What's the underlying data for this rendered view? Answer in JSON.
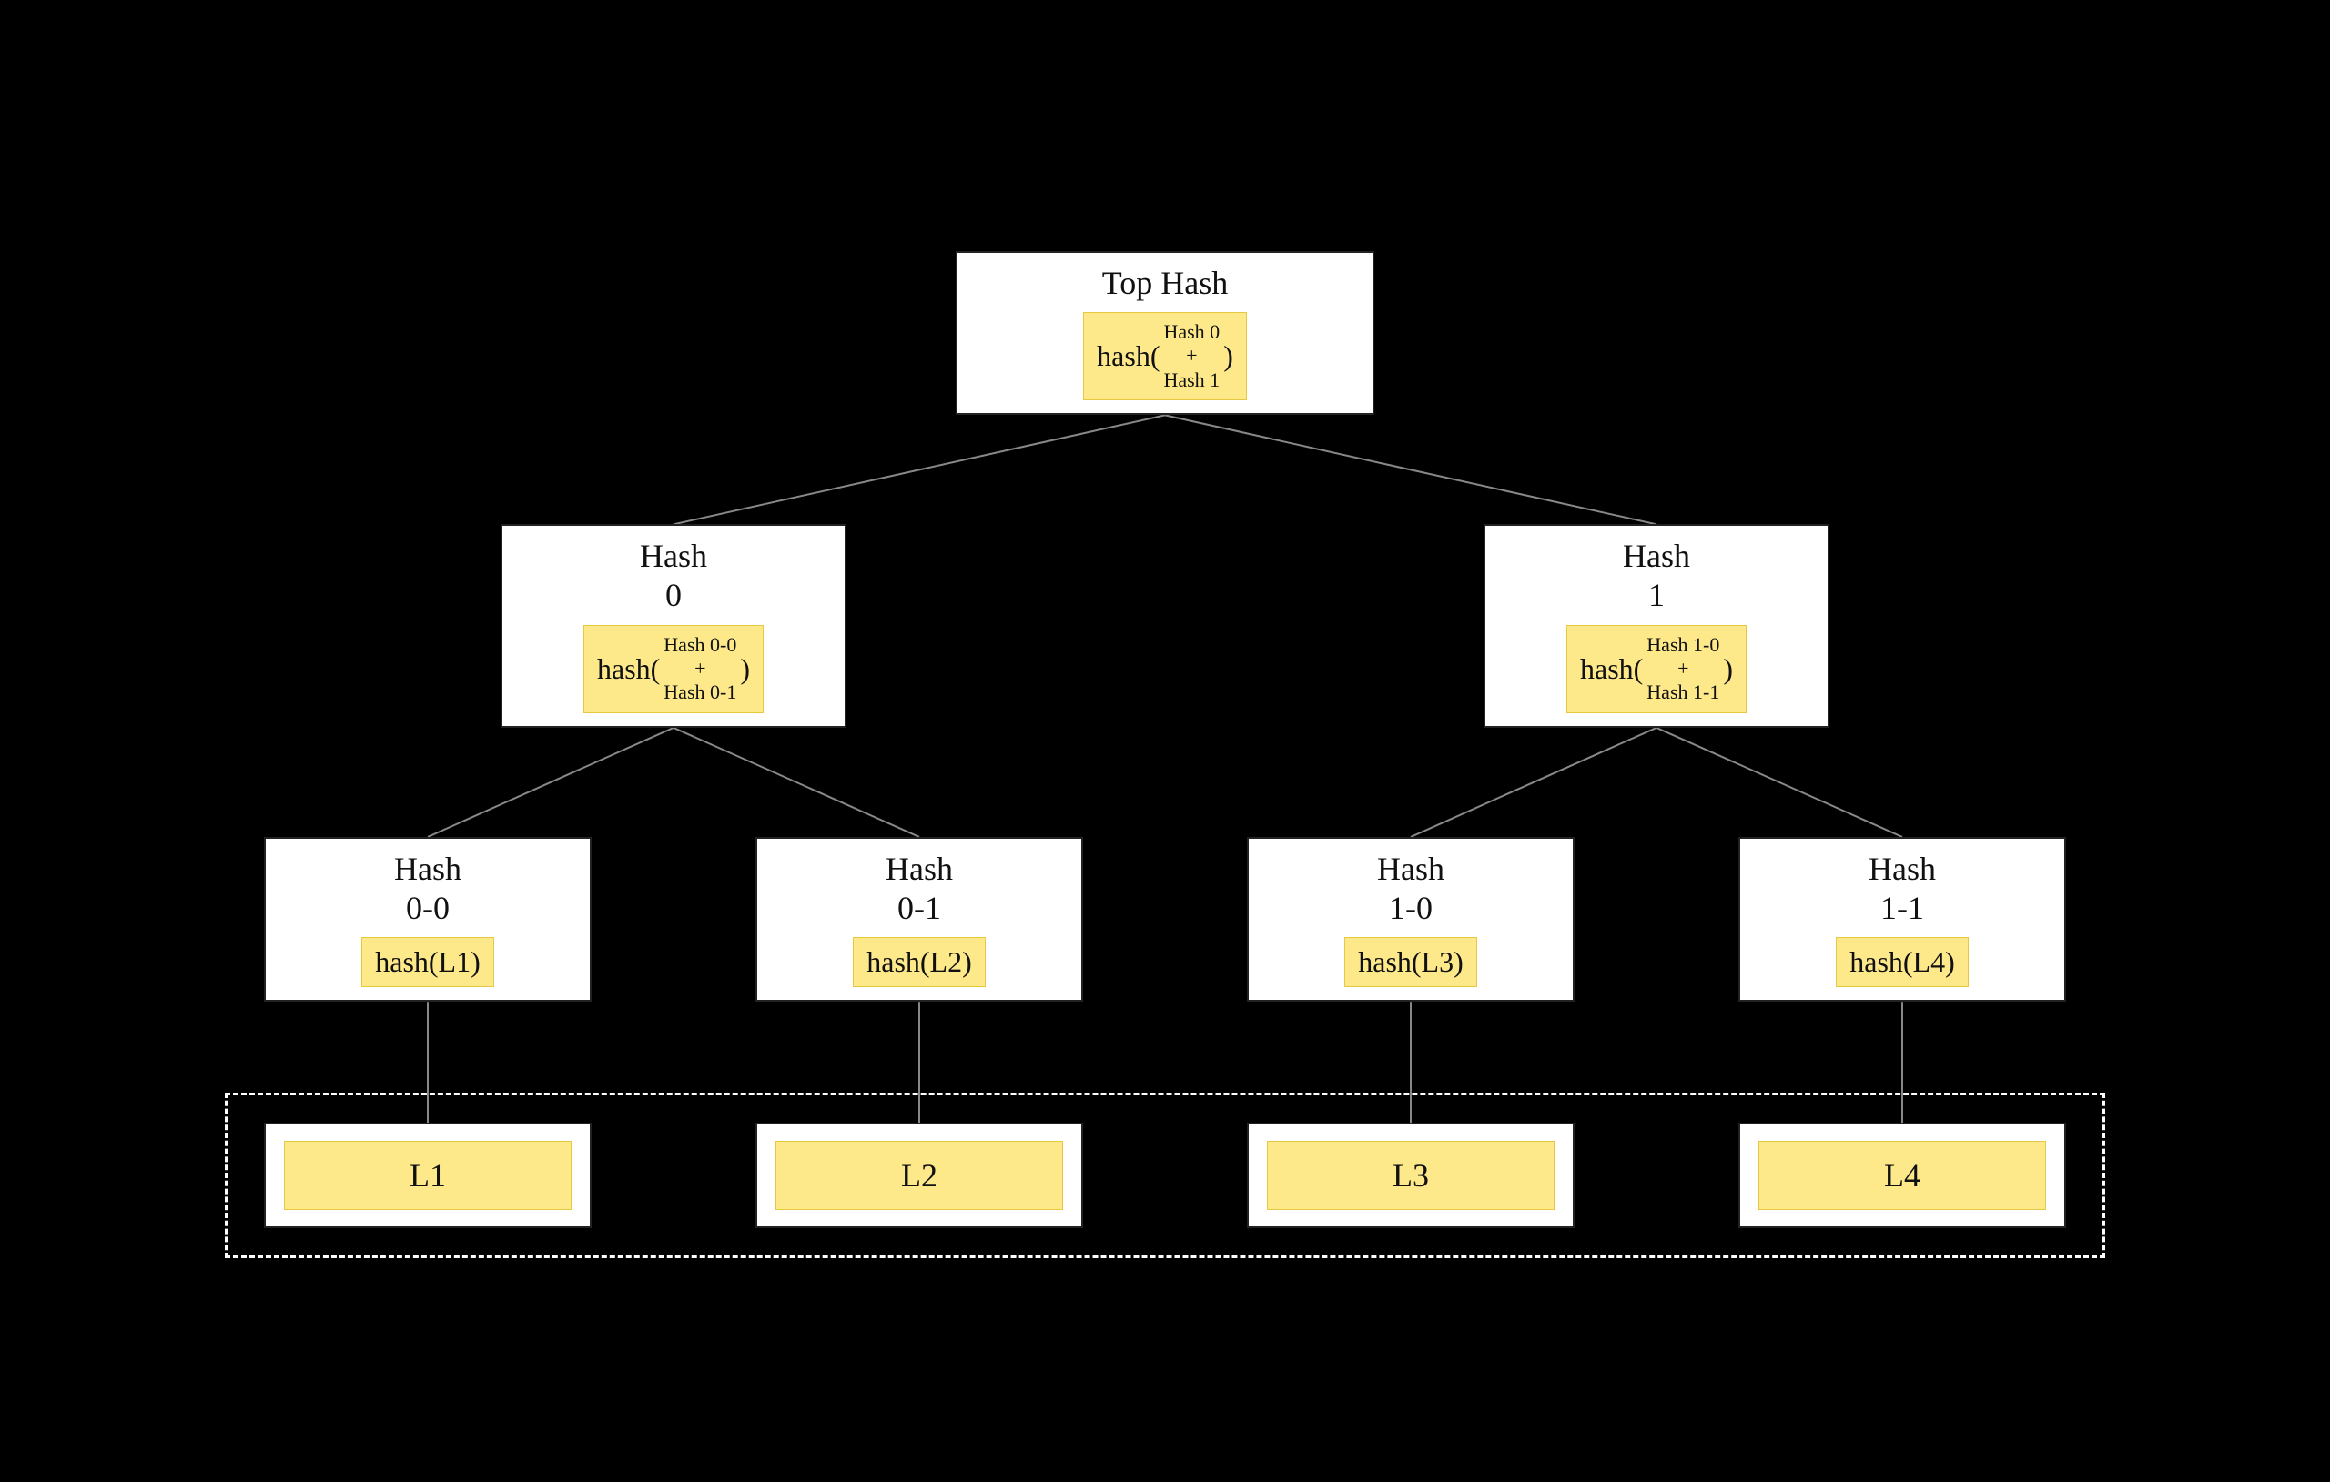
{
  "tree": {
    "top": {
      "title": "Top Hash",
      "formula_prefix": "hash(",
      "formula_content_line1": "Hash 0",
      "formula_content_plus": "+",
      "formula_content_line2": "Hash 1",
      "formula_suffix": ")"
    },
    "level1": [
      {
        "title_line1": "Hash",
        "title_line2": "0",
        "formula_prefix": "hash(",
        "formula_content_line1": "Hash 0-0",
        "formula_content_plus": "+",
        "formula_content_line2": "Hash 0-1",
        "formula_suffix": ")"
      },
      {
        "title_line1": "Hash",
        "title_line2": "1",
        "formula_prefix": "hash(",
        "formula_content_line1": "Hash 1-0",
        "formula_content_plus": "+",
        "formula_content_line2": "Hash 1-1",
        "formula_suffix": ")"
      }
    ],
    "level2": [
      {
        "title_line1": "Hash",
        "title_line2": "0-0",
        "formula": "hash(L1)"
      },
      {
        "title_line1": "Hash",
        "title_line2": "0-1",
        "formula": "hash(L2)"
      },
      {
        "title_line1": "Hash",
        "title_line2": "1-0",
        "formula": "hash(L3)"
      },
      {
        "title_line1": "Hash",
        "title_line2": "1-1",
        "formula": "hash(L4)"
      }
    ],
    "leaves": [
      {
        "label": "L1"
      },
      {
        "label": "L2"
      },
      {
        "label": "L3"
      },
      {
        "label": "L4"
      }
    ]
  }
}
